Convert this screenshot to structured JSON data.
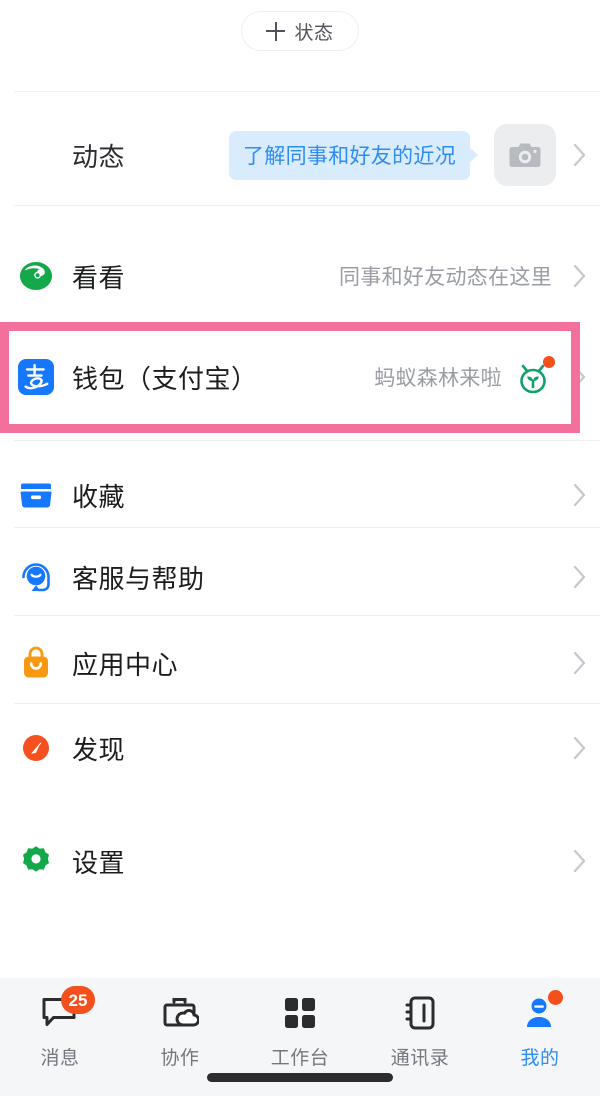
{
  "status_pill": {
    "label": "状态",
    "icon": "plus-icon"
  },
  "rows": [
    {
      "name": "dynamic",
      "label": "动态",
      "bubble": "了解同事和好友的近况",
      "icon": "camera-icon",
      "chevron": "chevron-right-icon"
    },
    {
      "name": "kankan",
      "label": "看看",
      "sub": "同事和好友动态在这里",
      "icon": "green-eye-icon",
      "chevron": "chevron-right-icon"
    },
    {
      "name": "wallet-alipay",
      "label": "钱包（支付宝）",
      "sub": "蚂蚁森林来啦",
      "icon": "alipay-icon",
      "trailing_icon": "ant-forest-icon",
      "chevron": "chevron-right-icon",
      "highlighted": true
    },
    {
      "name": "favorites",
      "label": "收藏",
      "icon": "folder-icon",
      "chevron": "chevron-right-icon"
    },
    {
      "name": "support-help",
      "label": "客服与帮助",
      "icon": "headset-icon",
      "chevron": "chevron-right-icon"
    },
    {
      "name": "app-center",
      "label": "应用中心",
      "icon": "shopping-bag-icon",
      "chevron": "chevron-right-icon"
    },
    {
      "name": "discover",
      "label": "发现",
      "icon": "compass-icon",
      "chevron": "chevron-right-icon"
    },
    {
      "name": "settings",
      "label": "设置",
      "icon": "gear-icon",
      "chevron": "chevron-right-icon"
    }
  ],
  "bottom_nav": {
    "items": [
      {
        "label": "消息",
        "icon": "chat-bubble-icon",
        "badge": "25",
        "active": false
      },
      {
        "label": "协作",
        "icon": "briefcase-cloud-icon",
        "active": false
      },
      {
        "label": "工作台",
        "icon": "grid-icon",
        "active": false
      },
      {
        "label": "通讯录",
        "icon": "contacts-icon",
        "active": false
      },
      {
        "label": "我的",
        "icon": "person-icon",
        "dot": true,
        "active": true
      }
    ]
  },
  "colors": {
    "accent_blue": "#2e8cf0",
    "highlight_pink": "#f4709c",
    "badge_orange": "#f4501e",
    "green": "#13a84a",
    "orange": "#f79a12",
    "bubble_bg": "#d9ecfd"
  }
}
